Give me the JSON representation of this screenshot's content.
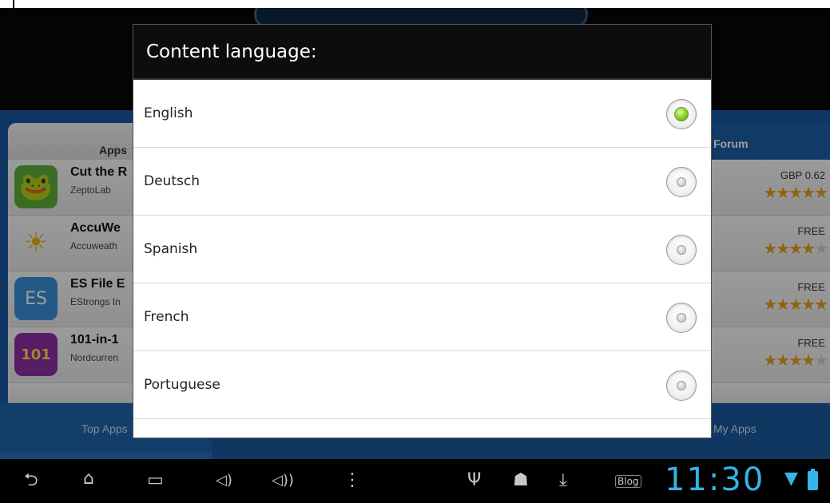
{
  "dialog": {
    "title": "Content language:",
    "options": [
      {
        "label": "English",
        "selected": true
      },
      {
        "label": "Deutsch",
        "selected": false
      },
      {
        "label": "Spanish",
        "selected": false
      },
      {
        "label": "French",
        "selected": false
      },
      {
        "label": "Portuguese",
        "selected": false
      }
    ]
  },
  "background": {
    "tabs": {
      "apps": "Apps",
      "forum": "Forum"
    },
    "apps": [
      {
        "name": "Cut the R",
        "developer": "ZeptoLab",
        "price": "GBP 0.62",
        "rating": 5,
        "icon": "cut-the-rope-icon"
      },
      {
        "name": "AccuWe",
        "developer": "Accuweath",
        "price": "FREE",
        "rating": 4,
        "icon": "accuweather-icon"
      },
      {
        "name": "ES File E",
        "developer": "EStrongs In",
        "price": "FREE",
        "rating": 5,
        "icon": "es-file-explorer-icon"
      },
      {
        "name": "101-in-1",
        "developer": "Nordcurren",
        "price": "FREE",
        "rating": 4,
        "icon": "101-in-1-games-icon"
      }
    ],
    "bottom_tabs": {
      "top_apps": "Top Apps",
      "my_apps": "My Apps"
    }
  },
  "system_bar": {
    "clock": "11:30",
    "icons": [
      "back-icon",
      "home-icon",
      "recent-apps-icon",
      "volume-down-icon",
      "volume-up-icon",
      "menu-icon",
      "usb-icon",
      "android-debug-icon",
      "download-icon",
      "blog-icon",
      "wifi-icon",
      "battery-icon"
    ],
    "accent_color": "#33b5e5"
  },
  "colors": {
    "radio_selected": "#7fc61f",
    "app_blue": "#1a5aa0"
  }
}
